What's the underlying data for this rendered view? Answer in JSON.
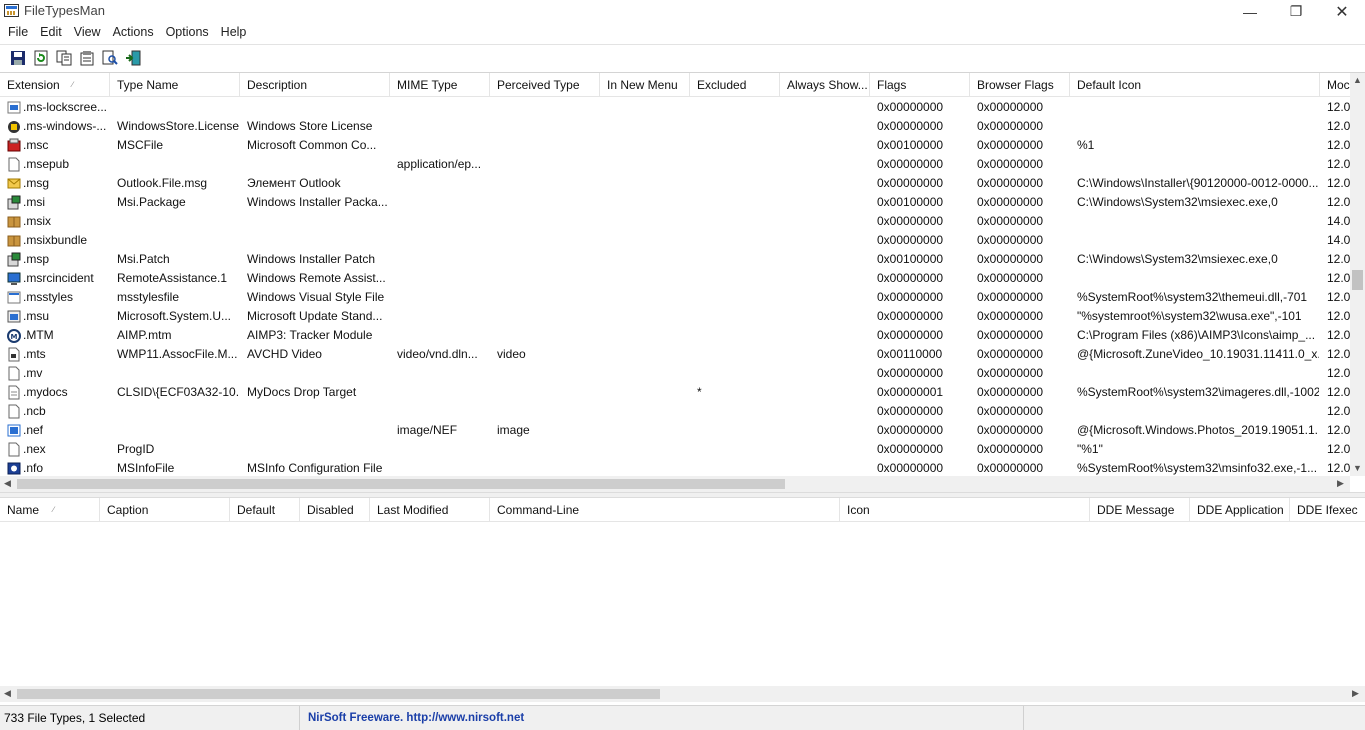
{
  "window": {
    "title": "FileTypesMan"
  },
  "menu": [
    "File",
    "Edit",
    "View",
    "Actions",
    "Options",
    "Help"
  ],
  "toolbar_icons": [
    "save-icon",
    "refresh-icon",
    "copy-icon",
    "properties-icon",
    "find-icon",
    "exit-icon"
  ],
  "upper_columns": [
    "Extension",
    "Type Name",
    "Description",
    "MIME Type",
    "Perceived Type",
    "In New Menu",
    "Excluded",
    "Always Show...",
    "Flags",
    "Browser Flags",
    "Default Icon",
    "Moc"
  ],
  "file_types": [
    {
      "icon": "lock-screen-icon",
      "ext": ".ms-lockscree...",
      "type": "",
      "desc": "",
      "mime": "",
      "perceived": "",
      "excluded": "",
      "flags": "0x00000000",
      "bflags": "0x00000000",
      "dicon": "",
      "mod": "12.0"
    },
    {
      "icon": "windows-store-icon",
      "ext": ".ms-windows-...",
      "type": "WindowsStore.License",
      "desc": "Windows Store License",
      "mime": "",
      "perceived": "",
      "excluded": "",
      "flags": "0x00000000",
      "bflags": "0x00000000",
      "dicon": "",
      "mod": "12.0"
    },
    {
      "icon": "msc-icon",
      "ext": ".msc",
      "type": "MSCFile",
      "desc": "Microsoft Common Co...",
      "mime": "",
      "perceived": "",
      "excluded": "",
      "flags": "0x00100000",
      "bflags": "0x00000000",
      "dicon": "%1",
      "mod": "12.0"
    },
    {
      "icon": "blank-file-icon",
      "ext": ".msepub",
      "type": "",
      "desc": "",
      "mime": "application/ep...",
      "perceived": "",
      "excluded": "",
      "flags": "0x00000000",
      "bflags": "0x00000000",
      "dicon": "",
      "mod": "12.0"
    },
    {
      "icon": "envelope-icon",
      "ext": ".msg",
      "type": "Outlook.File.msg",
      "desc": "Элемент Outlook",
      "mime": "",
      "perceived": "",
      "excluded": "",
      "flags": "0x00000000",
      "bflags": "0x00000000",
      "dicon": "C:\\Windows\\Installer\\{90120000-0012-0000...",
      "mod": "12.0"
    },
    {
      "icon": "installer-icon",
      "ext": ".msi",
      "type": "Msi.Package",
      "desc": "Windows Installer Packa...",
      "mime": "",
      "perceived": "",
      "excluded": "",
      "flags": "0x00100000",
      "bflags": "0x00000000",
      "dicon": "C:\\Windows\\System32\\msiexec.exe,0",
      "mod": "12.0"
    },
    {
      "icon": "package-icon",
      "ext": ".msix",
      "type": "",
      "desc": "",
      "mime": "",
      "perceived": "",
      "excluded": "",
      "flags": "0x00000000",
      "bflags": "0x00000000",
      "dicon": "",
      "mod": "14.0"
    },
    {
      "icon": "package-icon",
      "ext": ".msixbundle",
      "type": "",
      "desc": "",
      "mime": "",
      "perceived": "",
      "excluded": "",
      "flags": "0x00000000",
      "bflags": "0x00000000",
      "dicon": "",
      "mod": "14.0"
    },
    {
      "icon": "installer-icon",
      "ext": ".msp",
      "type": "Msi.Patch",
      "desc": "Windows Installer Patch",
      "mime": "",
      "perceived": "",
      "excluded": "",
      "flags": "0x00100000",
      "bflags": "0x00000000",
      "dicon": "C:\\Windows\\System32\\msiexec.exe,0",
      "mod": "12.0"
    },
    {
      "icon": "remote-assistance-icon",
      "ext": ".msrcincident",
      "type": "RemoteAssistance.1",
      "desc": "Windows Remote Assist...",
      "mime": "",
      "perceived": "",
      "excluded": "",
      "flags": "0x00000000",
      "bflags": "0x00000000",
      "dicon": "",
      "mod": "12.0"
    },
    {
      "icon": "visual-style-icon",
      "ext": ".msstyles",
      "type": "msstylesfile",
      "desc": "Windows Visual Style File",
      "mime": "",
      "perceived": "",
      "excluded": "",
      "flags": "0x00000000",
      "bflags": "0x00000000",
      "dicon": "%SystemRoot%\\system32\\themeui.dll,-701",
      "mod": "12.0"
    },
    {
      "icon": "update-icon",
      "ext": ".msu",
      "type": "Microsoft.System.U...",
      "desc": "Microsoft Update Stand...",
      "mime": "",
      "perceived": "",
      "excluded": "",
      "flags": "0x00000000",
      "bflags": "0x00000000",
      "dicon": "\"%systemroot%\\system32\\wusa.exe\",-101",
      "mod": "12.0"
    },
    {
      "icon": "aimp-icon",
      "ext": ".MTM",
      "type": "AIMP.mtm",
      "desc": "AIMP3: Tracker Module",
      "mime": "",
      "perceived": "",
      "excluded": "",
      "flags": "0x00000000",
      "bflags": "0x00000000",
      "dicon": "C:\\Program Files (x86)\\AIMP3\\Icons\\aimp_...",
      "mod": "12.0"
    },
    {
      "icon": "video-file-icon",
      "ext": ".mts",
      "type": "WMP11.AssocFile.M...",
      "desc": "AVCHD Video",
      "mime": "video/vnd.dln...",
      "perceived": "video",
      "excluded": "",
      "flags": "0x00110000",
      "bflags": "0x00000000",
      "dicon": "@{Microsoft.ZuneVideo_10.19031.11411.0_x...",
      "mod": "12.0"
    },
    {
      "icon": "blank-file-icon",
      "ext": ".mv",
      "type": "",
      "desc": "",
      "mime": "",
      "perceived": "",
      "excluded": "",
      "flags": "0x00000000",
      "bflags": "0x00000000",
      "dicon": "",
      "mod": "12.0"
    },
    {
      "icon": "document-icon",
      "ext": ".mydocs",
      "type": "CLSID\\{ECF03A32-10...",
      "desc": "MyDocs Drop Target",
      "mime": "",
      "perceived": "",
      "excluded": "*",
      "flags": "0x00000001",
      "bflags": "0x00000000",
      "dicon": "%SystemRoot%\\system32\\imageres.dll,-1002",
      "mod": "12.0"
    },
    {
      "icon": "blank-file-icon",
      "ext": ".ncb",
      "type": "",
      "desc": "",
      "mime": "",
      "perceived": "",
      "excluded": "",
      "flags": "0x00000000",
      "bflags": "0x00000000",
      "dicon": "",
      "mod": "12.0"
    },
    {
      "icon": "image-file-icon",
      "ext": ".nef",
      "type": "",
      "desc": "",
      "mime": "image/NEF",
      "perceived": "image",
      "excluded": "",
      "flags": "0x00000000",
      "bflags": "0x00000000",
      "dicon": "@{Microsoft.Windows.Photos_2019.19051.1...",
      "mod": "12.0"
    },
    {
      "icon": "blank-file-icon",
      "ext": ".nex",
      "type": "ProgID",
      "desc": "",
      "mime": "",
      "perceived": "",
      "excluded": "",
      "flags": "0x00000000",
      "bflags": "0x00000000",
      "dicon": "\"%1\"",
      "mod": "12.0"
    },
    {
      "icon": "msinfo-icon",
      "ext": ".nfo",
      "type": "MSInfoFile",
      "desc": "MSInfo Configuration File",
      "mime": "",
      "perceived": "",
      "excluded": "",
      "flags": "0x00000000",
      "bflags": "0x00000000",
      "dicon": "%SystemRoot%\\system32\\msinfo32.exe,-1...",
      "mod": "12.0"
    }
  ],
  "lower_columns": [
    "Name",
    "Caption",
    "Default",
    "Disabled",
    "Last Modified",
    "Command-Line",
    "Icon",
    "DDE Message",
    "DDE Application",
    "DDE Ifexec"
  ],
  "status": {
    "count": "733 File Types, 1 Selected",
    "link": "NirSoft Freeware.  http://www.nirsoft.net"
  }
}
